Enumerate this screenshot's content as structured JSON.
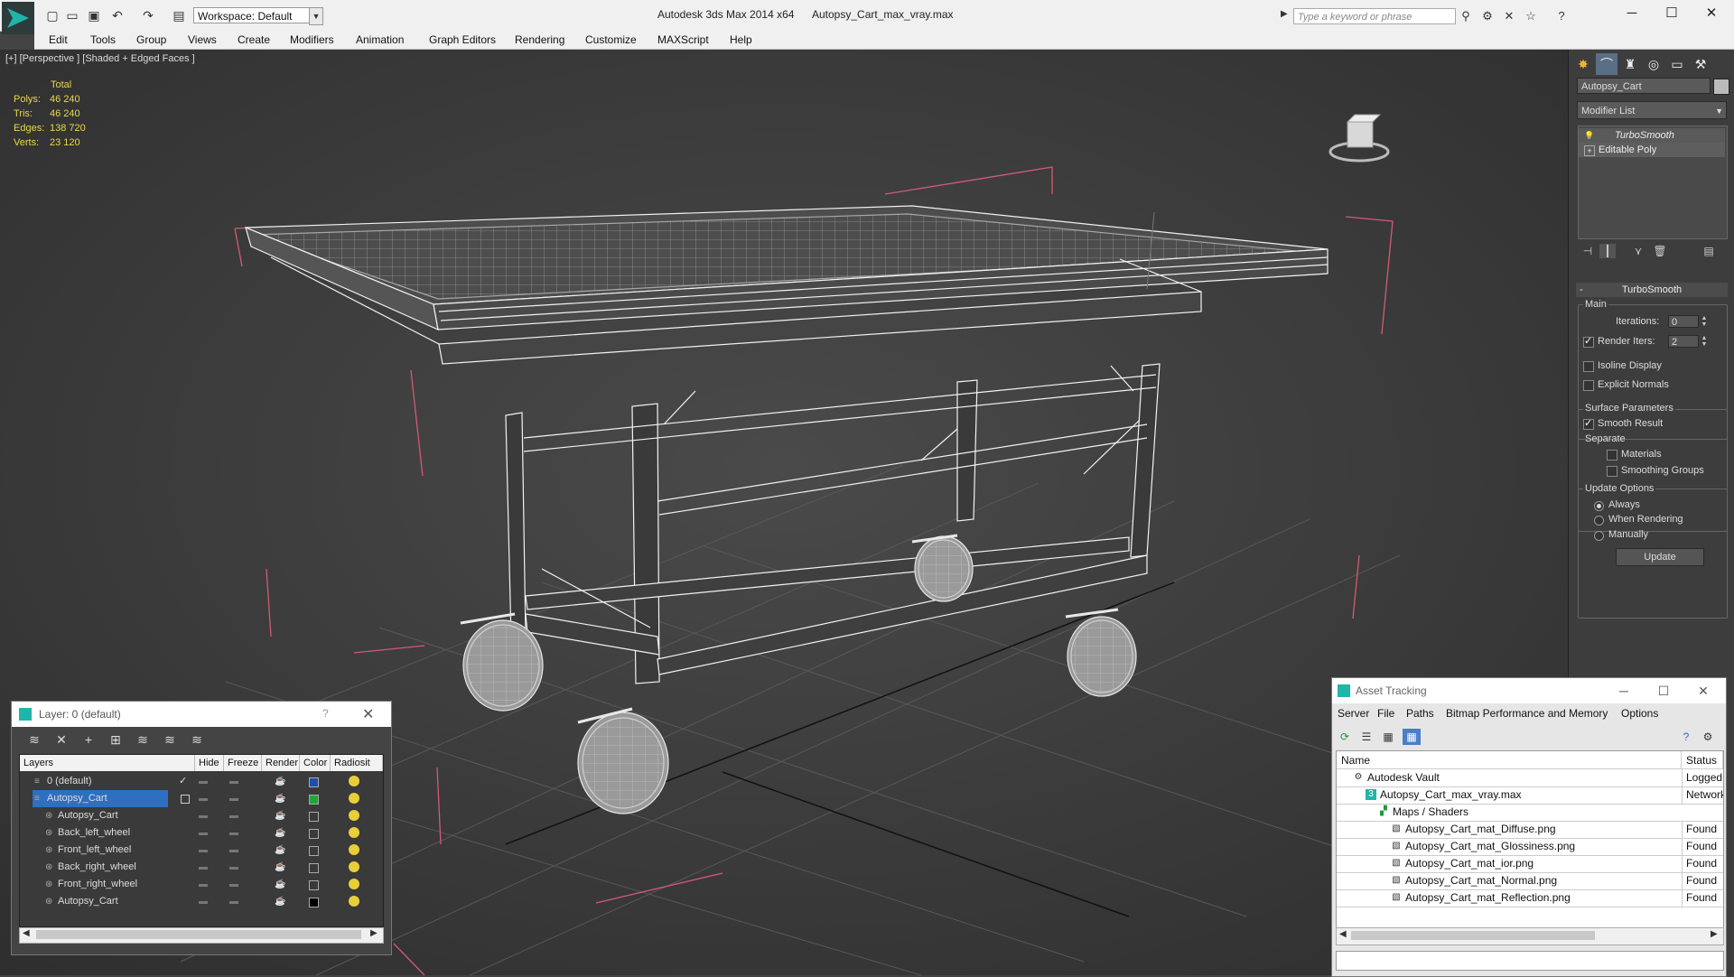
{
  "titlebar": {
    "workspace_label": "Workspace: Default",
    "app_title": "Autodesk 3ds Max  2014 x64",
    "file_title": "Autopsy_Cart_max_vray.max",
    "search_placeholder": "Type a keyword or phrase"
  },
  "menu": [
    "Edit",
    "Tools",
    "Group",
    "Views",
    "Create",
    "Modifiers",
    "Animation",
    "Graph Editors",
    "Rendering",
    "Customize",
    "MAXScript",
    "Help"
  ],
  "viewport": {
    "label": "[+] [Perspective ] [Shaded + Edged Faces ]",
    "stats": {
      "header": "Total",
      "rows": [
        {
          "label": "Polys:",
          "value": "46 240"
        },
        {
          "label": "Tris:",
          "value": "46 240"
        },
        {
          "label": "Edges:",
          "value": "138 720"
        },
        {
          "label": "Verts:",
          "value": "23 120"
        }
      ]
    }
  },
  "command_panel": {
    "object_name": "Autopsy_Cart",
    "modifier_list": "Modifier List",
    "stack": [
      "TurboSmooth",
      "Editable Poly"
    ],
    "rollout_title": "TurboSmooth",
    "main_group": "Main",
    "iterations_label": "Iterations:",
    "iterations_value": "0",
    "render_iters_label": "Render Iters:",
    "render_iters_value": "2",
    "isoline_label": "Isoline Display",
    "explicit_label": "Explicit Normals",
    "surface_group": "Surface Parameters",
    "smooth_result_label": "Smooth Result",
    "separate_label": "Separate",
    "materials_label": "Materials",
    "smoothing_groups_label": "Smoothing Groups",
    "update_group": "Update Options",
    "always_label": "Always",
    "when_rendering_label": "When Rendering",
    "manually_label": "Manually",
    "update_button": "Update"
  },
  "layer_dialog": {
    "title": "Layer: 0 (default)",
    "help": "?",
    "columns": [
      "Layers",
      "Hide",
      "Freeze",
      "Render",
      "Color",
      "Radiosit"
    ],
    "rows": [
      {
        "name": "0 (default)",
        "indent": 1,
        "color": "#1e4fa8",
        "check": true
      },
      {
        "name": "Autopsy_Cart",
        "indent": 1,
        "color": "#1fa83a",
        "selected": true
      },
      {
        "name": "Autopsy_Cart",
        "indent": 2,
        "color": ""
      },
      {
        "name": "Back_left_wheel",
        "indent": 2,
        "color": ""
      },
      {
        "name": "Front_left_wheel",
        "indent": 2,
        "color": ""
      },
      {
        "name": "Back_right_wheel",
        "indent": 2,
        "color": ""
      },
      {
        "name": "Front_right_wheel",
        "indent": 2,
        "color": ""
      },
      {
        "name": "Autopsy_Cart",
        "indent": 2,
        "color": "#000000"
      }
    ]
  },
  "asset_dialog": {
    "title": "Asset Tracking",
    "menu": [
      "Server",
      "File",
      "Paths",
      "Bitmap Performance and Memory",
      "Options"
    ],
    "columns": [
      "Name",
      "Status"
    ],
    "rows": [
      {
        "name": "Autodesk Vault",
        "indent": 1,
        "status": "Logged O",
        "icon": "vault-icon"
      },
      {
        "name": "Autopsy_Cart_max_vray.max",
        "indent": 2,
        "status": "Network F",
        "icon": "max-file-icon"
      },
      {
        "name": "Maps / Shaders",
        "indent": 3,
        "status": "",
        "icon": "maps-icon"
      },
      {
        "name": "Autopsy_Cart_mat_Diffuse.png",
        "indent": 4,
        "status": "Found",
        "icon": "bitmap-icon"
      },
      {
        "name": "Autopsy_Cart_mat_Glossiness.png",
        "indent": 4,
        "status": "Found",
        "icon": "bitmap-icon"
      },
      {
        "name": "Autopsy_Cart_mat_ior.png",
        "indent": 4,
        "status": "Found",
        "icon": "bitmap-icon"
      },
      {
        "name": "Autopsy_Cart_mat_Normal.png",
        "indent": 4,
        "status": "Found",
        "icon": "bitmap-icon"
      },
      {
        "name": "Autopsy_Cart_mat_Reflection.png",
        "indent": 4,
        "status": "Found",
        "icon": "bitmap-icon"
      }
    ]
  }
}
